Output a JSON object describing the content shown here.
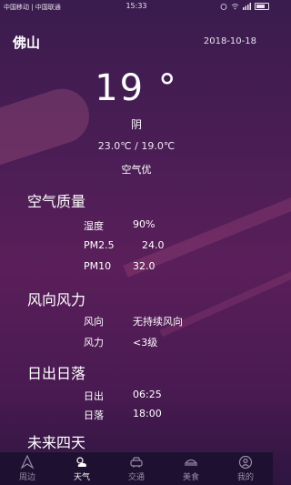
{
  "status_bar": {
    "carrier": "中国移动 | 中国联通",
    "time": "15:33"
  },
  "header": {
    "city": "佛山",
    "date": "2018-10-18"
  },
  "current": {
    "temperature": "19 °",
    "condition": "阴",
    "range": "23.0℃ / 19.0℃",
    "air_summary": "空气优"
  },
  "air_quality": {
    "title": "空气质量",
    "rows": [
      {
        "label": "湿度",
        "value": "90%"
      },
      {
        "label": "PM2.5",
        "value": "24.0"
      },
      {
        "label": "PM10",
        "value": "32.0"
      }
    ]
  },
  "wind": {
    "title": "风向风力",
    "rows": [
      {
        "label": "风向",
        "value": "无持续风向"
      },
      {
        "label": "风力",
        "value": "<3级"
      }
    ]
  },
  "sun": {
    "title": "日出日落",
    "rows": [
      {
        "label": "日出",
        "value": "06:25"
      },
      {
        "label": "日落",
        "value": "18:00"
      }
    ]
  },
  "forecast": {
    "title": "未来四天"
  },
  "nav": {
    "items": [
      {
        "label": "周边",
        "icon": "location-icon"
      },
      {
        "label": "天气",
        "icon": "weather-icon"
      },
      {
        "label": "交通",
        "icon": "car-icon"
      },
      {
        "label": "美食",
        "icon": "food-icon"
      },
      {
        "label": "我的",
        "icon": "profile-icon"
      }
    ],
    "active": "天气"
  },
  "colors": {
    "background": "#4a1d55",
    "nav_background": "#1e1030",
    "nav_inactive": "#9a8aa8",
    "text": "#ffffff"
  }
}
